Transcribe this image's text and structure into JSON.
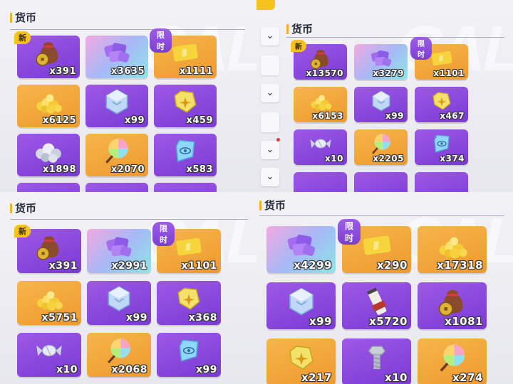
{
  "panels": [
    {
      "title": "货币",
      "tags": {
        "xin": "新",
        "xian": "限时"
      },
      "items": [
        {
          "icon": "coin-pouch-icon",
          "qty": "x391"
        },
        {
          "icon": "purple-tickets-icon",
          "qty": "x3635"
        },
        {
          "icon": "gold-ticket-icon",
          "qty": "x1111"
        },
        {
          "icon": "gold-nugget-pile-icon",
          "qty": "x6125"
        },
        {
          "icon": "crystal-cube-icon",
          "qty": "x99"
        },
        {
          "icon": "yellow-gem-icon",
          "qty": "x459"
        },
        {
          "icon": "silver-ore-pile-icon",
          "qty": "x1898"
        },
        {
          "icon": "lollipop-icon",
          "qty": "x2070"
        },
        {
          "icon": "blue-eye-gem-icon",
          "qty": "x583"
        }
      ]
    },
    {
      "title": "货币",
      "tags": {
        "xin": "新",
        "xian": "限时"
      },
      "items": [
        {
          "icon": "coin-pouch-icon",
          "qty": "x13570"
        },
        {
          "icon": "purple-tickets-icon",
          "qty": "x3279"
        },
        {
          "icon": "gold-ticket-icon",
          "qty": "x1101"
        },
        {
          "icon": "gold-nugget-pile-icon",
          "qty": "x6153"
        },
        {
          "icon": "crystal-cube-icon",
          "qty": "x99"
        },
        {
          "icon": "yellow-gem-icon",
          "qty": "x467"
        },
        {
          "icon": "candy-icon",
          "qty": "x10"
        },
        {
          "icon": "lollipop-icon",
          "qty": "x2205"
        },
        {
          "icon": "blue-eye-gem-icon",
          "qty": "x374"
        }
      ],
      "side_buttons": [
        "chevron-down-icon",
        "chevron-down-icon",
        "chevron-down-icon",
        "chevron-down-icon"
      ]
    },
    {
      "title": "货币",
      "tags": {
        "xin": "新",
        "xian": "限时"
      },
      "items": [
        {
          "icon": "coin-pouch-icon",
          "qty": "x391"
        },
        {
          "icon": "purple-tickets-icon",
          "qty": "x2991"
        },
        {
          "icon": "gold-ticket-icon",
          "qty": "x1101"
        },
        {
          "icon": "gold-nugget-pile-icon",
          "qty": "x5751"
        },
        {
          "icon": "crystal-cube-icon",
          "qty": "x99"
        },
        {
          "icon": "yellow-gem-icon",
          "qty": "x368"
        },
        {
          "icon": "candy-icon",
          "qty": "x10"
        },
        {
          "icon": "lollipop-icon",
          "qty": "x2068"
        },
        {
          "icon": "blue-eye-gem-icon",
          "qty": "x99"
        }
      ]
    },
    {
      "title": "货币",
      "tags": {
        "xian": "限时"
      },
      "items": [
        {
          "icon": "purple-tickets-icon",
          "qty": "x4299"
        },
        {
          "icon": "gold-ticket-icon",
          "qty": "x290"
        },
        {
          "icon": "gold-nugget-pile-icon",
          "qty": "x17318"
        },
        {
          "icon": "crystal-cube-icon",
          "qty": "x99"
        },
        {
          "icon": "scroll-icon",
          "qty": "x5720"
        },
        {
          "icon": "coin-pouch-icon",
          "qty": "x1081"
        },
        {
          "icon": "yellow-gem-icon",
          "qty": "x217"
        },
        {
          "icon": "bolt-icon",
          "qty": "x10"
        },
        {
          "icon": "lollipop-icon",
          "qty": "x274"
        }
      ]
    }
  ]
}
